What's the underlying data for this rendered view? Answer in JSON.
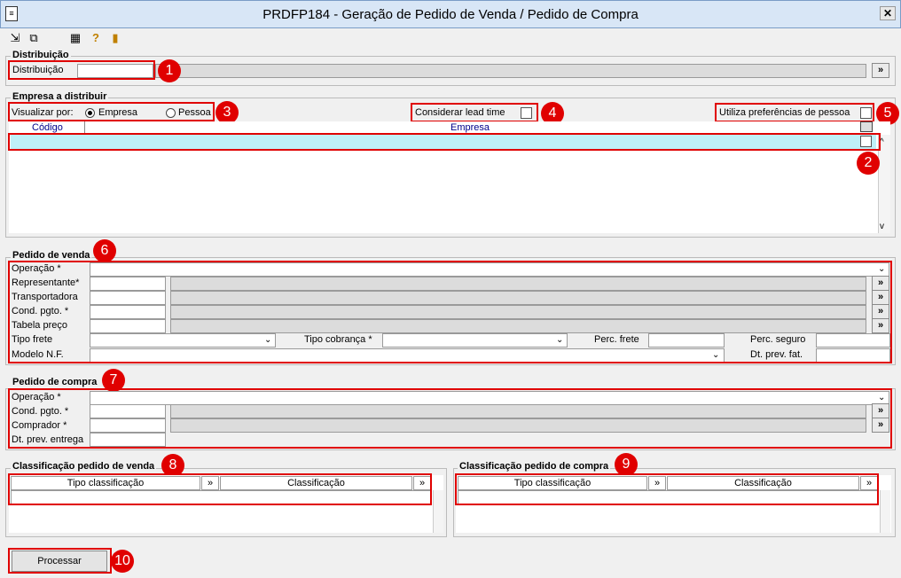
{
  "window": {
    "title": "PRDFP184 - Geração de Pedido de Venda / Pedido de Compra",
    "close": "✕"
  },
  "toolbar": {
    "icons": [
      "export-icon",
      "copy-icon",
      "table-icon",
      "help-icon",
      "exit-icon"
    ]
  },
  "distribuicao": {
    "legend": "Distribuição",
    "label": "Distribuição",
    "btn": "»"
  },
  "empresa": {
    "legend": "Empresa a distribuir",
    "visualizar": "Visualizar por:",
    "opt1": "Empresa",
    "opt2": "Pessoa",
    "lead": "Considerar lead time",
    "pref": "Utiliza preferências de pessoa",
    "col_codigo": "Código",
    "col_empresa": "Empresa"
  },
  "venda": {
    "legend": "Pedido de venda",
    "operacao": "Operação *",
    "representante": "Representante*",
    "transportadora": "Transportadora",
    "cond": "Cond. pgto. *",
    "tabela": "Tabela preço",
    "tipo_frete": "Tipo frete",
    "tipo_cobranca": "Tipo cobrança *",
    "perc_frete": "Perc. frete",
    "perc_seguro": "Perc. seguro",
    "modelo": "Modelo N.F.",
    "dt_prev_fat": "Dt. prev. fat."
  },
  "compra": {
    "legend": "Pedido de compra",
    "operacao": "Operação *",
    "cond": "Cond. pgto. *",
    "comprador": "Comprador *",
    "dt_prev": "Dt. prev. entrega"
  },
  "class_venda": {
    "legend": "Classificação pedido de venda",
    "col1": "Tipo classificação",
    "col2": "Classificação",
    "btn": "»"
  },
  "class_compra": {
    "legend": "Classificação pedido de compra",
    "col1": "Tipo classificação",
    "col2": "Classificação",
    "btn": "»"
  },
  "processar": "Processar",
  "badges": [
    "1",
    "2",
    "3",
    "4",
    "5",
    "6",
    "7",
    "8",
    "9",
    "10"
  ]
}
